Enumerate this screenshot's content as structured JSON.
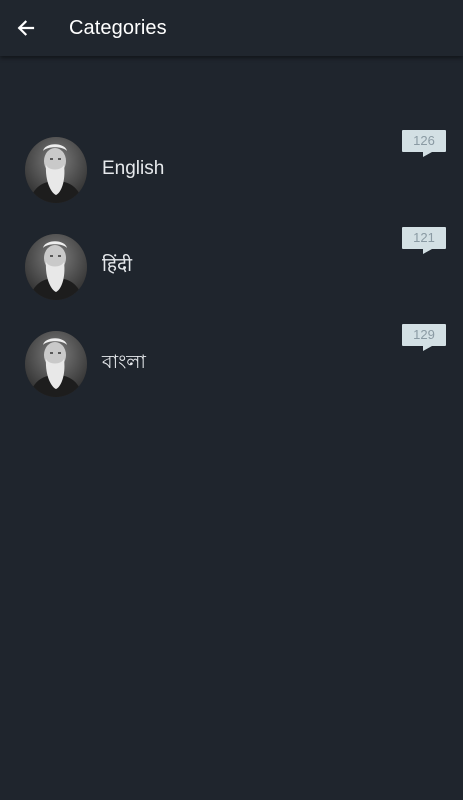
{
  "toolbar": {
    "title": "Categories",
    "back_icon": "arrow-left-icon"
  },
  "categories": [
    {
      "label": "English",
      "count": "126",
      "avatar_icon": "portrait-avatar"
    },
    {
      "label": "हिंदी",
      "count": "121",
      "avatar_icon": "portrait-avatar"
    },
    {
      "label": "বাংলা",
      "count": "129",
      "avatar_icon": "portrait-avatar"
    }
  ],
  "colors": {
    "background": "#1f252d",
    "toolbar": "#20262e",
    "badge": "#d3e0e4",
    "badge_text": "#8a9aa3",
    "text": "#e6e9ec"
  }
}
